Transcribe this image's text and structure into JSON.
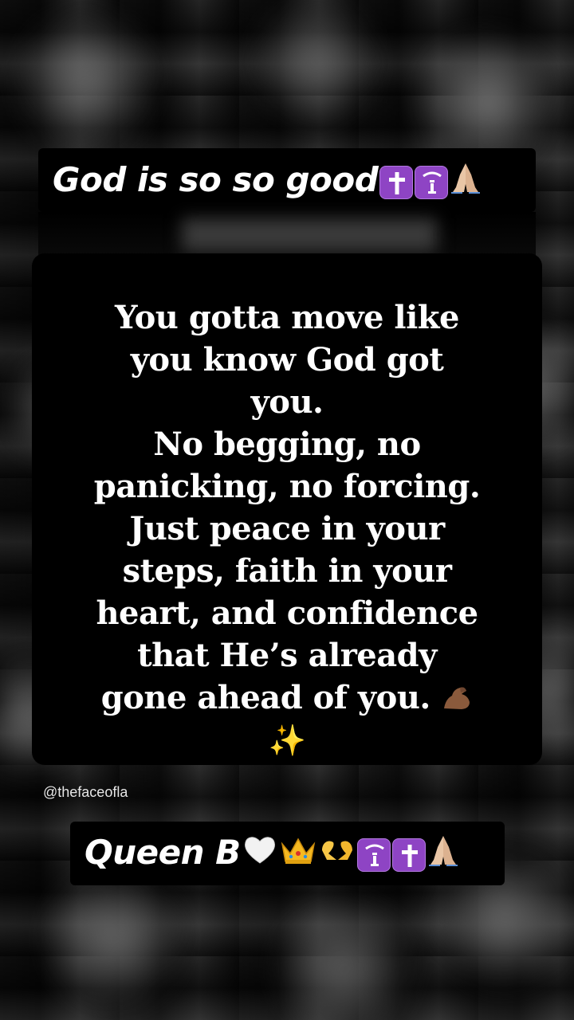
{
  "story": {
    "top_caption": "God is so so good",
    "top_caption_emojis": [
      "latin-cross-icon",
      "om-icon",
      "praying-hands-icon"
    ],
    "quote_lines": [
      "You gotta move like",
      "you know God got",
      "you.",
      "No begging, no",
      "panicking, no forcing.",
      "Just peace in your",
      "steps, faith in your",
      "heart, and confidence",
      "that He’s already",
      "gone ahead of you."
    ],
    "quote_trailing_emojis": [
      "flexed-biceps-icon",
      "sparkles-icon"
    ],
    "handle": "@thefaceofla",
    "bottom_caption": "Queen B",
    "bottom_caption_emojis": [
      "white-heart-icon",
      "crown-icon",
      "heart-hands-icon",
      "om-icon",
      "latin-cross-icon",
      "praying-hands-icon"
    ],
    "sparkles_glyph": "✨",
    "colors": {
      "emoji_purple": "#8e44c4",
      "card_background": "#000000",
      "text": "#ffffff"
    }
  }
}
